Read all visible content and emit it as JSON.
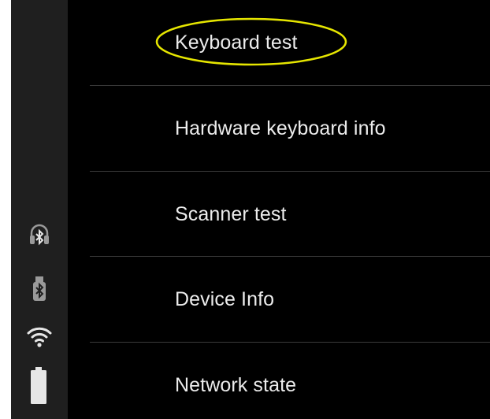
{
  "status_bar": {
    "icons": [
      "bluetooth-headset-icon",
      "bluetooth-usb-icon",
      "wifi-icon",
      "battery-icon"
    ],
    "colors": {
      "background": "#1f1f1f",
      "icon": "#e6e6e6",
      "dim_icon": "#9a9a9a"
    }
  },
  "menu": {
    "items": [
      {
        "label": "Keyboard test",
        "highlighted": true
      },
      {
        "label": "Hardware keyboard info"
      },
      {
        "label": "Scanner test"
      },
      {
        "label": "Device Info"
      },
      {
        "label": "Network state"
      }
    ]
  },
  "annotation": {
    "shape": "ellipse",
    "color": "#e6e600",
    "target": "Keyboard test"
  },
  "colors": {
    "background": "#000000",
    "text": "#ececec",
    "divider": "#3a3a3a"
  }
}
